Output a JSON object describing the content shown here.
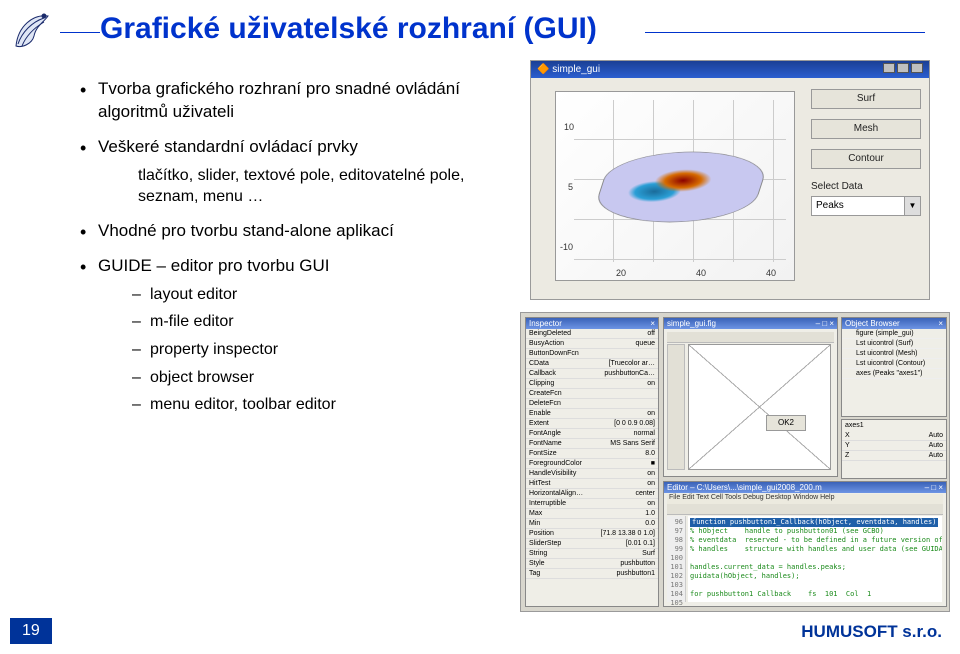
{
  "title": "Grafické uživatelské rozhraní (GUI)",
  "bullets": {
    "b1": "Tvorba grafického rozhraní pro snadné ovládání algoritmů uživateli",
    "b2": "Veškeré standardní ovládací prvky",
    "b2_sub": "tlačítko, slider, textové pole, editovatelné pole, seznam, menu …",
    "b3": "Vhodné pro tvorbu stand-alone aplikací",
    "b4": "GUIDE – editor pro tvorbu GUI",
    "b4_subs": {
      "s1": "layout editor",
      "s2": "m-file editor",
      "s3": "property inspector",
      "s4": "object browser",
      "s5": "menu editor, toolbar editor"
    }
  },
  "fig_top": {
    "title": "simple_gui",
    "axis_ticks": {
      "y": [
        "10",
        "5",
        "-10"
      ],
      "x": [
        "20",
        "40",
        "40"
      ]
    },
    "buttons": {
      "b1": "Surf",
      "b2": "Mesh",
      "b3": "Contour"
    },
    "label": "Select Data",
    "select_value": "Peaks"
  },
  "propinspect": {
    "title": "Inspector",
    "rows": [
      [
        "BeingDeleted",
        "off"
      ],
      [
        "BusyAction",
        "queue"
      ],
      [
        "ButtonDownFcn",
        ""
      ],
      [
        "CData",
        "[Truecolor ar…"
      ],
      [
        "Callback",
        "pushbuttonCa…"
      ],
      [
        "Clipping",
        "on"
      ],
      [
        "CreateFcn",
        ""
      ],
      [
        "DeleteFcn",
        ""
      ],
      [
        "Enable",
        "on"
      ],
      [
        "Extent",
        "[0 0 0.9 0.08]"
      ],
      [
        "FontAngle",
        "normal"
      ],
      [
        "FontName",
        "MS Sans Serif"
      ],
      [
        "FontSize",
        "8.0"
      ],
      [
        "ForegroundColor",
        "■"
      ],
      [
        "HandleVisibility",
        "on"
      ],
      [
        "HitTest",
        "on"
      ],
      [
        "HorizontalAlign…",
        "center"
      ],
      [
        "Interruptible",
        "on"
      ],
      [
        "Max",
        "1.0"
      ],
      [
        "Min",
        "0.0"
      ],
      [
        "Position",
        "[71.8 13.38 0 1.0]"
      ],
      [
        "SliderStep",
        "[0.01 0.1]"
      ],
      [
        "String",
        "Surf"
      ],
      [
        "Style",
        "pushbutton"
      ],
      [
        "Tag",
        "pushbutton1"
      ]
    ]
  },
  "layout": {
    "title": "simple_gui.fig",
    "okbtn": "OK2"
  },
  "objbrowser": {
    "title": "Object Browser",
    "rows": [
      "figure (simple_gui)",
      "  Lst uicontrol (Surf)",
      "  Lst uicontrol (Mesh)",
      "  Lst uicontrol (Contour)",
      "  axes (Peaks \"axes1\")"
    ]
  },
  "axes_panel": {
    "title": "axes1",
    "rows": [
      [
        "X",
        "Auto"
      ],
      [
        "Y",
        "Auto"
      ],
      [
        "Z",
        "Auto"
      ]
    ]
  },
  "editor": {
    "title": "Editor – C:\\Users\\...\\simple_gui2008_200.m",
    "menubar": "File  Edit  Text  Cell  Tools  Debug  Desktop  Window  Help",
    "lines_gutter": "96\n97\n98\n99\n100\n101\n102\n103\n104\n105",
    "code_hl": "function pushbutton1_Callback(hObject, eventdata, handles)",
    "code_rest": "% hObject    handle to pushbutton01 (see GCBO)\n% eventdata  reserved - to be defined in a future version of MATLAB\n% handles    structure with handles and user data (see GUIDATA)\n\nhandles.current_data = handles.peaks;\nguidata(hObject, handles);\n\nfor pushbutton1 Callback    fs  101  Col  1"
  },
  "footer": {
    "page": "19",
    "company": "HUMUSOFT s.r.o."
  }
}
